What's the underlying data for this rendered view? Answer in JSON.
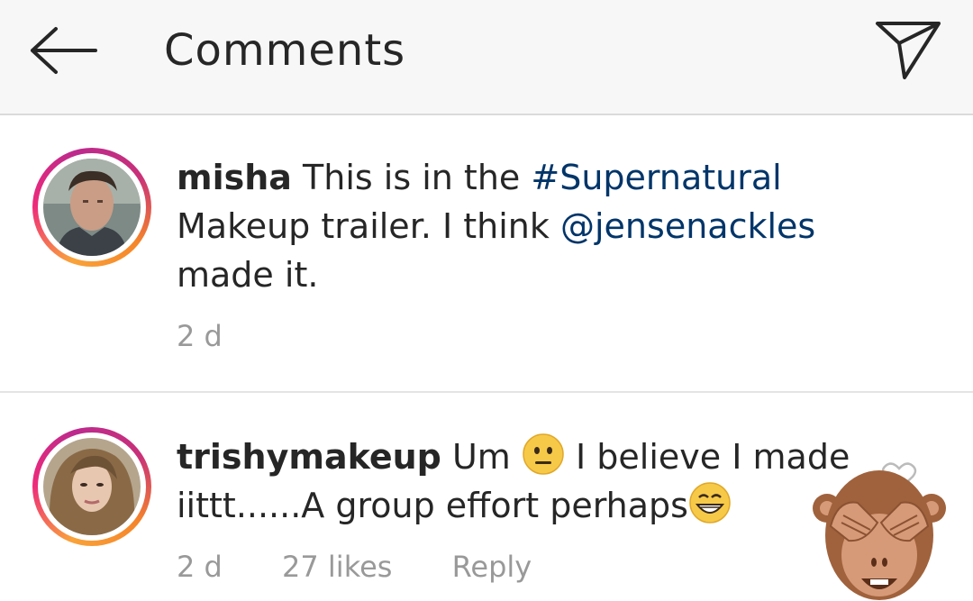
{
  "header": {
    "title": "Comments",
    "back_icon": "arrow-left-icon",
    "share_icon": "paper-plane-icon"
  },
  "comments": [
    {
      "username": "misha",
      "text_before": "This is in the",
      "hashtag": "#Supernatural",
      "text_mid": "Makeup trailer. I think",
      "mention": "@jensenackles",
      "text_after": "made it.",
      "time": "2 d"
    },
    {
      "username": "trishymakeup",
      "text_start": "Um",
      "emoji_1": "neutral-face-emoji",
      "text_mid": "I believe I made iittt......A group effort perhaps",
      "emoji_2": "grinning-face-emoji",
      "time": "2 d",
      "likes": "27 likes",
      "reply": "Reply",
      "like_icon": "heart-outline-icon"
    }
  ],
  "sticker": "see-no-evil-monkey-emoji",
  "colors": {
    "link": "#003569",
    "text": "#262626",
    "meta": "#999999",
    "header_bg": "#f7f7f7"
  }
}
